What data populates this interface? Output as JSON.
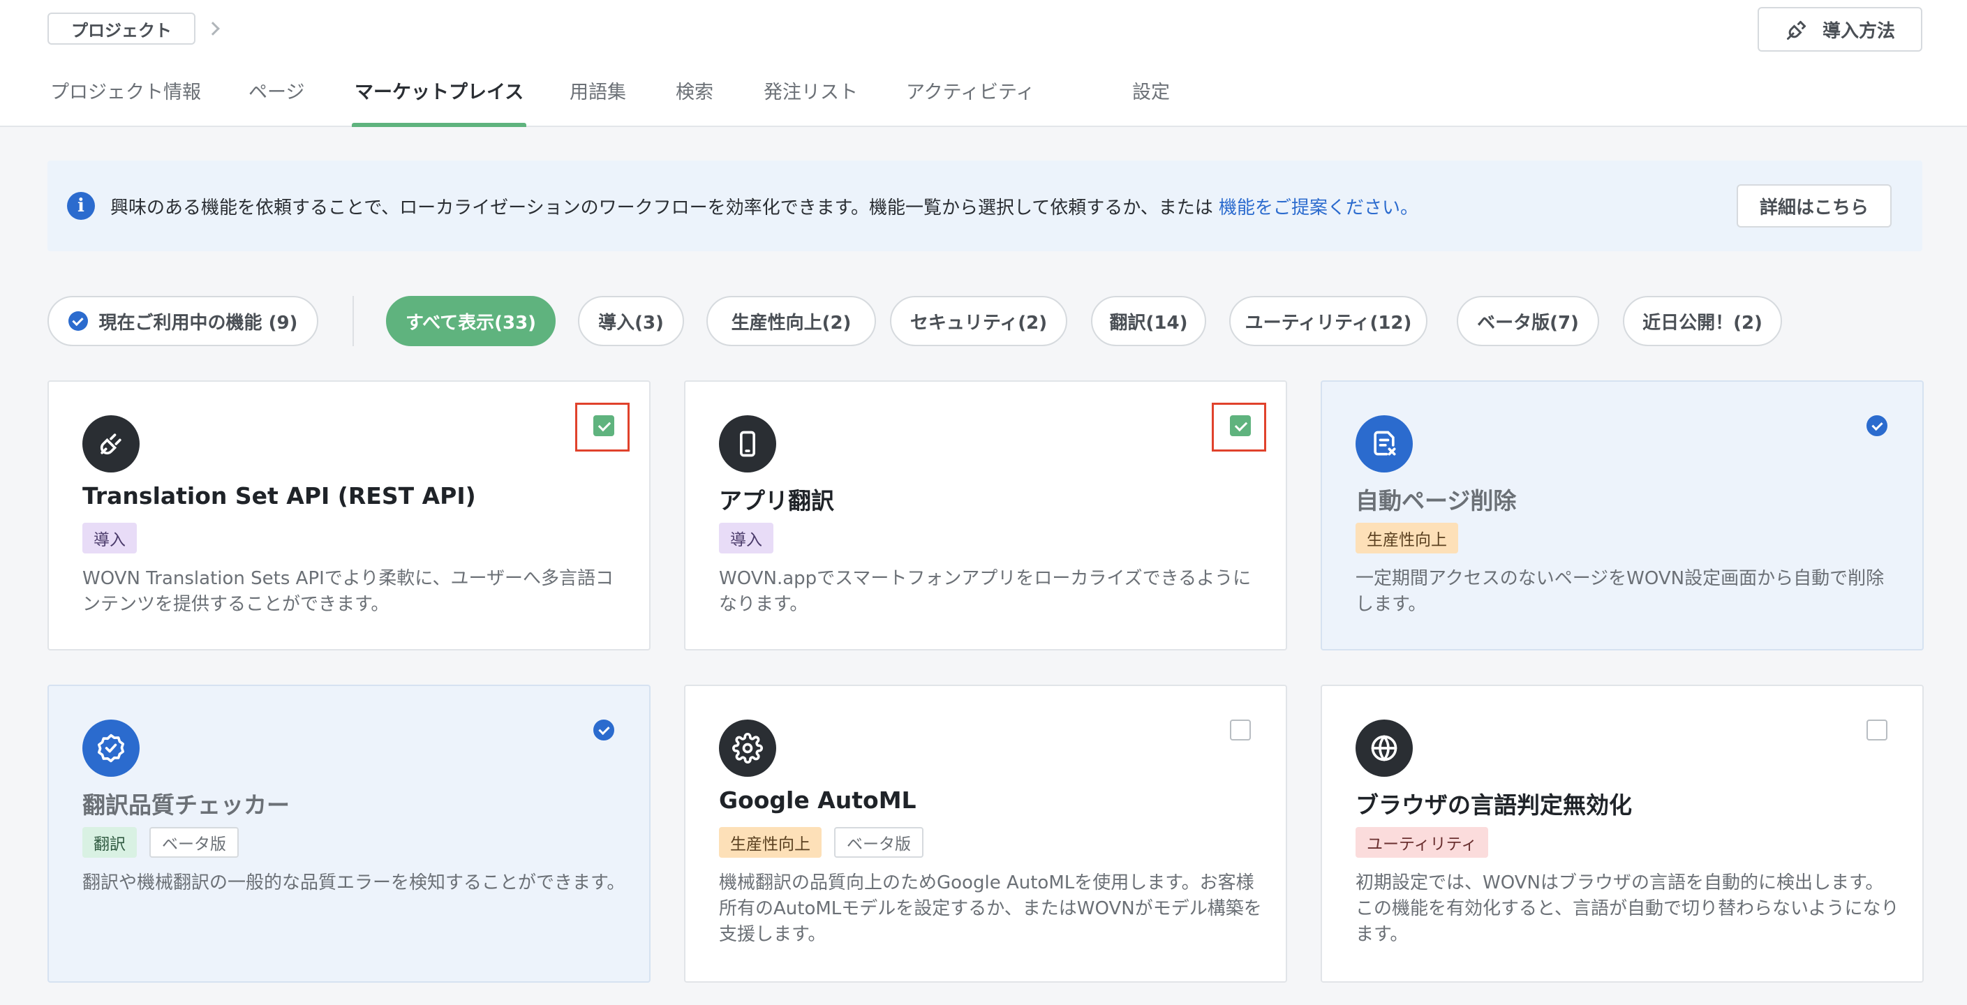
{
  "breadcrumb": {
    "project_label": "プロジェクト"
  },
  "header": {
    "setup_label": "導入方法"
  },
  "tabs": [
    {
      "label": "プロジェクト情報"
    },
    {
      "label": "ページ"
    },
    {
      "label": "マーケットプレイス"
    },
    {
      "label": "用語集"
    },
    {
      "label": "検索"
    },
    {
      "label": "発注リスト"
    },
    {
      "label": "アクティビティ"
    },
    {
      "label": "設定"
    }
  ],
  "active_tab": "マーケットプレイス",
  "banner": {
    "text": "興味のある機能を依頼することで、ローカライゼーションのワークフローを効率化できます。機能一覧から選択して依頼するか、または ",
    "link": "機能をご提案ください。",
    "button_label": "詳細はこちら"
  },
  "filters": {
    "current_label": "現在ご利用中の機能 (9)",
    "chips": [
      {
        "label": "すべて表示(33)",
        "active": true
      },
      {
        "label": "導入(3)"
      },
      {
        "label": "生産性向上(2)"
      },
      {
        "label": "セキュリティ(2)"
      },
      {
        "label": "翻訳(14)"
      },
      {
        "label": "ユーティリティ(12)"
      },
      {
        "label": "ベータ版(7)"
      },
      {
        "label": "近日公開！(2)"
      }
    ]
  },
  "cards": [
    {
      "title": "Translation Set API (REST API)",
      "icon": "plug-icon",
      "tags": [
        "導入"
      ],
      "description": "WOVN Translation Sets APIでより柔軟に、ユーザーへ多言語コンテンツを提供することができます。",
      "state": "checked"
    },
    {
      "title": "アプリ翻訳",
      "icon": "smartphone-icon",
      "tags": [
        "導入"
      ],
      "description": "WOVN.appでスマートフォンアプリをローカライズできるようになります。",
      "state": "checked"
    },
    {
      "title": "自動ページ削除",
      "icon": "document-delete-icon",
      "tags": [
        "生産性向上"
      ],
      "description": "一定期間アクセスのないページをWOVN設定画面から自動で削除します。",
      "state": "enabled"
    },
    {
      "title": "翻訳品質チェッカー",
      "icon": "badge-check-icon",
      "tags": [
        "翻訳",
        "ベータ版"
      ],
      "description": "翻訳や機械翻訳の一般的な品質エラーを検知することができます。",
      "state": "enabled"
    },
    {
      "title": "Google AutoML",
      "icon": "gear-icon",
      "tags": [
        "生産性向上",
        "ベータ版"
      ],
      "description": "機械翻訳の品質向上のためGoogle AutoMLを使用します。お客様所有のAutoMLモデルを設定するか、またはWOVNがモデル構築を支援します。",
      "state": "unchecked"
    },
    {
      "title": "ブラウザの言語判定無効化",
      "icon": "globe-icon",
      "tags": [
        "ユーティリティ"
      ],
      "description": "初期設定では、WOVNはブラウザの言語を自動的に検出します。この機能を有効化すると、言語が自動で切り替わらないようになります。",
      "state": "unchecked"
    }
  ]
}
